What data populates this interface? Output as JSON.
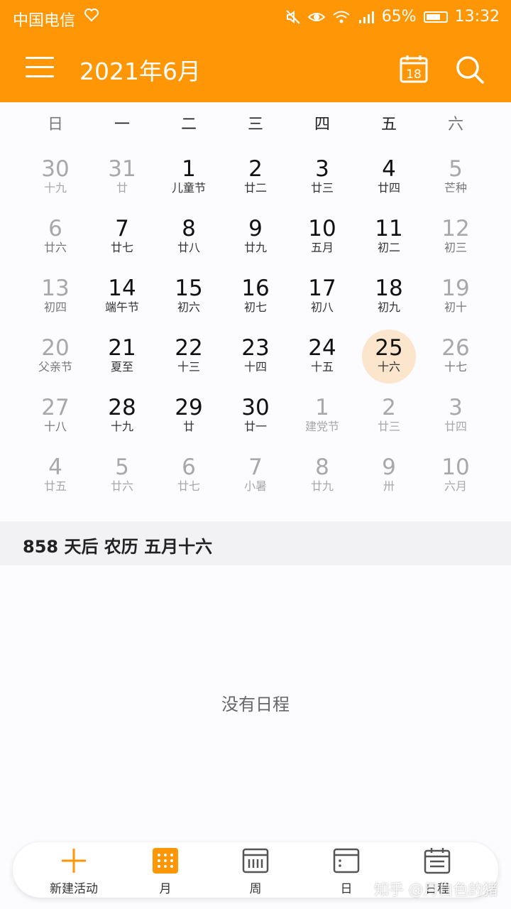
{
  "status_bar": {
    "carrier": "中国电信",
    "battery": "65%",
    "time": "13:32"
  },
  "app_bar": {
    "title": "2021年6月",
    "today_day": "18"
  },
  "weekdays": [
    "日",
    "一",
    "二",
    "三",
    "四",
    "五",
    "六"
  ],
  "calendar": [
    [
      {
        "day": "30",
        "lunar": "十九",
        "dim": true
      },
      {
        "day": "31",
        "lunar": "廿",
        "dim": true
      },
      {
        "day": "1",
        "lunar": "儿童节"
      },
      {
        "day": "2",
        "lunar": "廿二"
      },
      {
        "day": "3",
        "lunar": "廿三"
      },
      {
        "day": "4",
        "lunar": "廿四"
      },
      {
        "day": "5",
        "lunar": "芒种"
      }
    ],
    [
      {
        "day": "6",
        "lunar": "廿六"
      },
      {
        "day": "7",
        "lunar": "廿七"
      },
      {
        "day": "8",
        "lunar": "廿八"
      },
      {
        "day": "9",
        "lunar": "廿九"
      },
      {
        "day": "10",
        "lunar": "五月"
      },
      {
        "day": "11",
        "lunar": "初二"
      },
      {
        "day": "12",
        "lunar": "初三"
      }
    ],
    [
      {
        "day": "13",
        "lunar": "初四"
      },
      {
        "day": "14",
        "lunar": "端午节"
      },
      {
        "day": "15",
        "lunar": "初六"
      },
      {
        "day": "16",
        "lunar": "初七"
      },
      {
        "day": "17",
        "lunar": "初八"
      },
      {
        "day": "18",
        "lunar": "初九"
      },
      {
        "day": "19",
        "lunar": "初十"
      }
    ],
    [
      {
        "day": "20",
        "lunar": "父亲节"
      },
      {
        "day": "21",
        "lunar": "夏至"
      },
      {
        "day": "22",
        "lunar": "十三"
      },
      {
        "day": "23",
        "lunar": "十四"
      },
      {
        "day": "24",
        "lunar": "十五"
      },
      {
        "day": "25",
        "lunar": "十六",
        "selected": true
      },
      {
        "day": "26",
        "lunar": "十七"
      }
    ],
    [
      {
        "day": "27",
        "lunar": "十八"
      },
      {
        "day": "28",
        "lunar": "十九"
      },
      {
        "day": "29",
        "lunar": "廿"
      },
      {
        "day": "30",
        "lunar": "廿一"
      },
      {
        "day": "1",
        "lunar": "建党节",
        "dim": true
      },
      {
        "day": "2",
        "lunar": "廿三",
        "dim": true
      },
      {
        "day": "3",
        "lunar": "廿四",
        "dim": true
      }
    ],
    [
      {
        "day": "4",
        "lunar": "廿五",
        "dim": true
      },
      {
        "day": "5",
        "lunar": "廿六",
        "dim": true
      },
      {
        "day": "6",
        "lunar": "廿七",
        "dim": true
      },
      {
        "day": "7",
        "lunar": "小暑",
        "dim": true
      },
      {
        "day": "8",
        "lunar": "廿九",
        "dim": true
      },
      {
        "day": "9",
        "lunar": "卅",
        "dim": true
      },
      {
        "day": "10",
        "lunar": "六月",
        "dim": true
      }
    ]
  ],
  "info": "858 天后 农历 五月十六",
  "empty_text": "没有日程",
  "nav": {
    "new_event": "新建活动",
    "month": "月",
    "week": "周",
    "day": "日",
    "agenda": "日程"
  },
  "watermark": "知乎 @月白色的猪",
  "colors": {
    "accent": "#fe9605",
    "selected_bg": "#fbe5cc"
  }
}
